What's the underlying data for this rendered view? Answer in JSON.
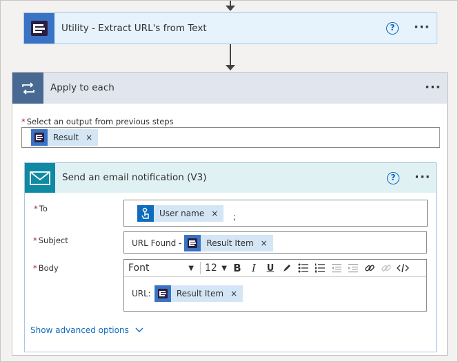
{
  "utility_action": {
    "title": "Utility - Extract URL's from Text",
    "icon": "document-extract-icon",
    "help_label": "?",
    "more_label": "···"
  },
  "apply_each": {
    "title": "Apply to each",
    "icon": "loop-icon",
    "more_label": "···",
    "select_label": "Select an output from previous steps",
    "required_mark": "*",
    "selected_token": {
      "label": "Result",
      "remove": "×"
    }
  },
  "email_action": {
    "title": "Send an email notification (V3)",
    "icon": "mail-icon",
    "help_label": "?",
    "more_label": "···",
    "to": {
      "label": "To",
      "token": {
        "label": "User name",
        "remove": "×"
      },
      "trailing_text": ";"
    },
    "subject": {
      "label": "Subject",
      "prefix_text": "URL Found -",
      "token": {
        "label": "Result Item",
        "remove": "×"
      }
    },
    "body": {
      "label": "Body",
      "toolbar": {
        "font": "Font",
        "size": "12",
        "bold": "B",
        "italic": "I",
        "underline": "U"
      },
      "prefix_text": "URL:",
      "token": {
        "label": "Result Item",
        "remove": "×"
      }
    },
    "show_advanced": "Show advanced options"
  },
  "colors": {
    "utility_accent": "#3a73c4",
    "loop_accent": "#486991",
    "mail_accent": "#0f8aa2",
    "token_bg": "#d4e6f5",
    "link": "#0f6cbd",
    "required": "#a4262c"
  }
}
